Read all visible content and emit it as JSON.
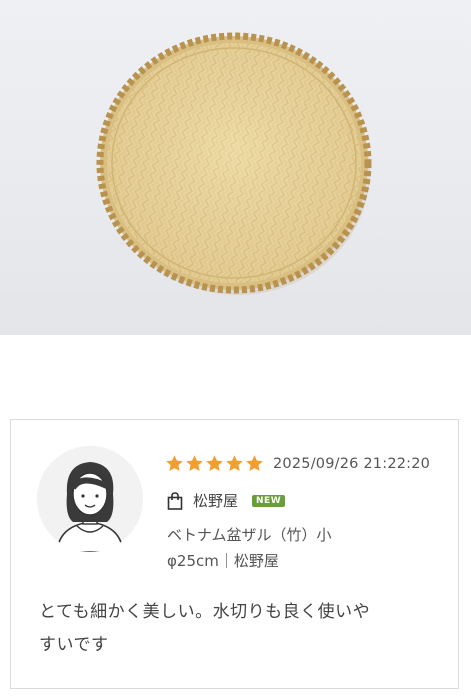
{
  "hero": {
    "image_name": "bamboo-colander-photo"
  },
  "review": {
    "rating": 5,
    "rating_max": 5,
    "date": "2025/09/26 21:22:20",
    "shop_icon": "shopping-bag-icon",
    "shop_name": "松野屋",
    "badge": "NEW",
    "product_line1": "ベトナム盆ザル（竹）小",
    "product_line2": "φ25cm｜松野屋",
    "text_line1": "とても細かく美しい。水切りも良く使いや",
    "text_line2": "すいです"
  },
  "colors": {
    "star": "#f0a030",
    "badge": "#6b9e3a",
    "border": "#dcdcdc"
  }
}
